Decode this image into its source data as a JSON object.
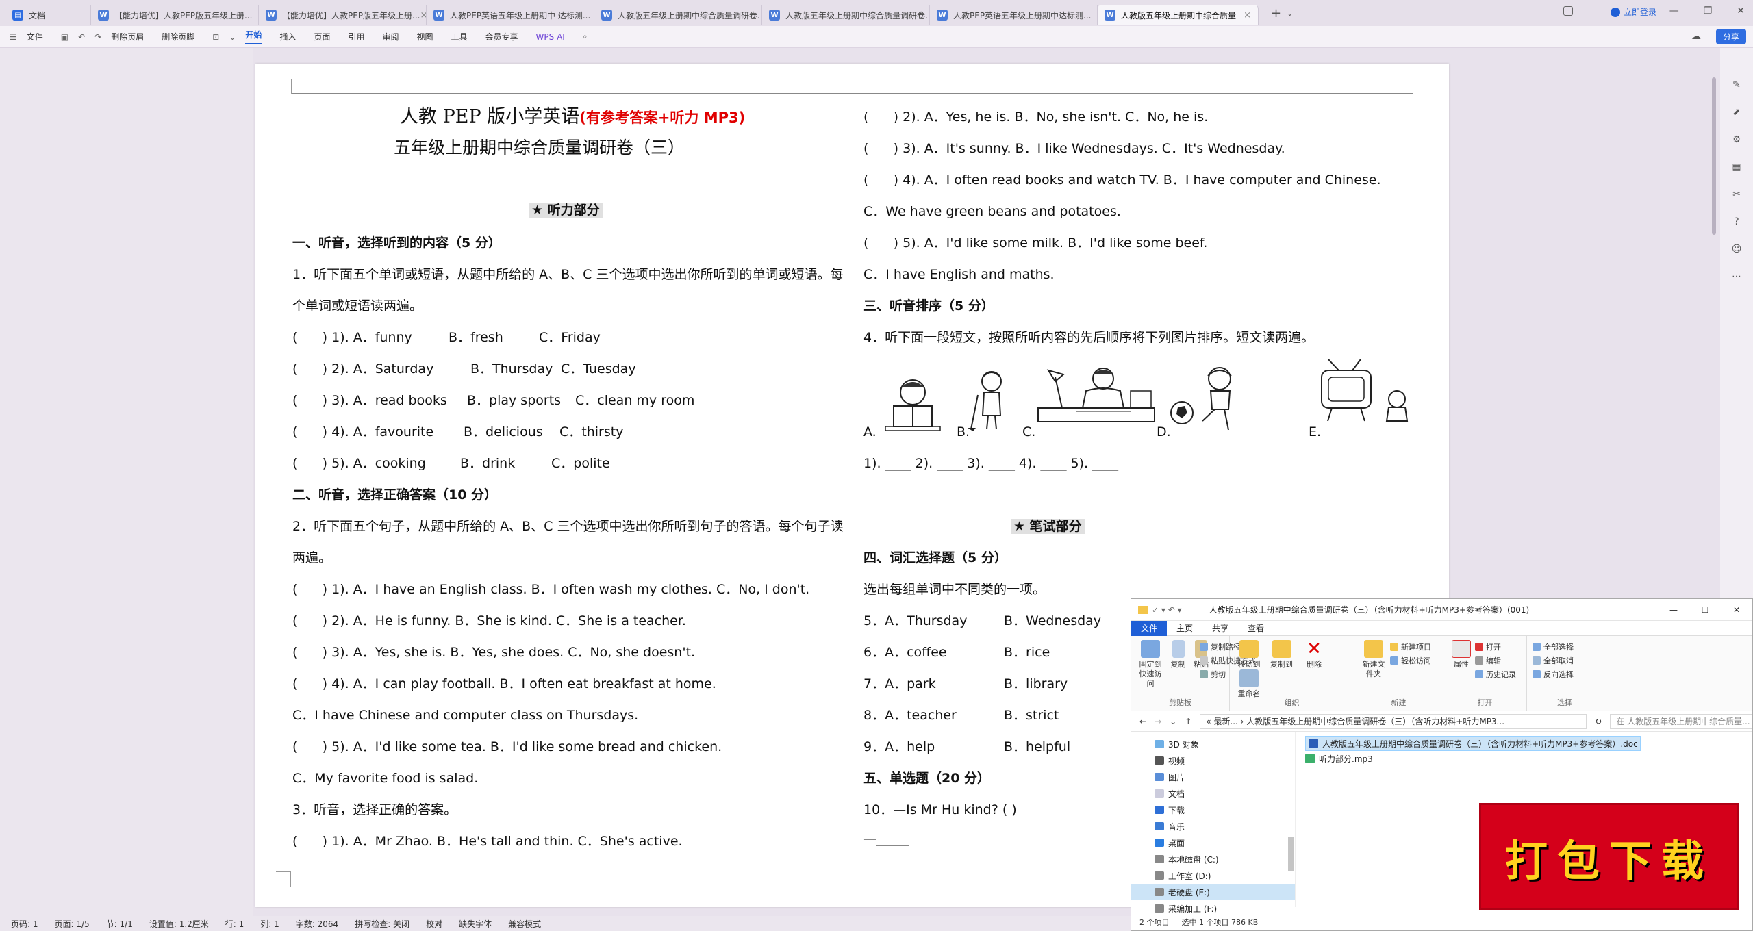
{
  "tabs": [
    {
      "label": "文档",
      "first": true
    },
    {
      "label": "【能力培优】人教PEP版五年级上册..."
    },
    {
      "label": "【能力培优】人教PEP版五年级上册..."
    },
    {
      "label": "人教PEP英语五年级上册期中 达标测..."
    },
    {
      "label": "人教版五年级上册期中综合质量调研卷..."
    },
    {
      "label": "人教版五年级上册期中综合质量调研卷..."
    },
    {
      "label": "人教PEP英语五年级上册期中达标测..."
    },
    {
      "label": "人教版五年级上册期中综合质量"
    }
  ],
  "login": "立即登录",
  "ribbon": {
    "file": "文件",
    "delete_header": "删除页眉",
    "delete_footer": "删除页脚",
    "menus": [
      "开始",
      "插入",
      "页面",
      "引用",
      "审阅",
      "视图",
      "工具",
      "会员专享"
    ],
    "wps_ai": "WPS AI",
    "share": "分享"
  },
  "doc": {
    "title_main": "人教 PEP 版小学英语",
    "title_red": "(有参考答案+听力 MP3)",
    "subtitle": "五年级上册期中综合质量调研卷（三）",
    "listen_section": "★ 听力部分",
    "s1": "一、听音，选择听到的内容（5 分）",
    "s1_desc1": "1．听下面五个单词或短语，从题中所给的 A、B、C 三个选项中选出你所听到的单词或短语。每",
    "s1_desc2": "个单词或短语读两遍。",
    "s1_items": [
      {
        "n": "1).",
        "a": "A．funny",
        "b": "B．fresh",
        "c": "C．Friday"
      },
      {
        "n": "2).",
        "a": "A．Saturday",
        "b": "B．Thursday",
        "c": "C．Tuesday"
      },
      {
        "n": "3).",
        "a": "A．read books",
        "b": "B．play sports",
        "c": "C．clean my room"
      },
      {
        "n": "4).",
        "a": "A．favourite",
        "b": "B．delicious",
        "c": "C．thirsty"
      },
      {
        "n": "5).",
        "a": "A．cooking",
        "b": "B．drink",
        "c": "C．polite"
      }
    ],
    "s2": "二、听音，选择正确答案（10 分）",
    "s2_desc1": "2．听下面五个句子，从题中所给的 A、B、C 三个选项中选出你所听到句子的答语。每个句子读",
    "s2_desc2": "两遍。",
    "s2_items": [
      "1). A．I have an English class.   B．I often wash my clothes.   C．No, I don't.",
      "2). A．He is funny.     B．She is kind.     C．She is a teacher.",
      "3). A．Yes, she is.     B．Yes, she does.    C．No, she doesn't.",
      "4). A．I can play football.   B．I often eat breakfast at home."
    ],
    "s2_i4c": "C．I have Chinese and computer class on Thursdays.",
    "s2_i5": "5). A．I'd like some tea.   B．I'd like some bread and chicken.",
    "s2_i5c": "C．My favorite food is salad.",
    "s3_desc": "3．听音，选择正确的答案。",
    "s3_i1": "1). A．Mr Zhao.              B．He's tall and thin.              C．She's active.",
    "r_items": [
      "2). A．Yes, he is.              B．No, she isn't.               C．No, he is.",
      "3). A．It's sunny.              B．I like Wednesdays.             C．It's Wednesday.",
      "4). A．I often read books and watch TV.     B．I have computer and Chinese."
    ],
    "r_i4c": "C．We have green beans and potatoes.",
    "r_i5": "5). A．I'd like some milk.        B．I'd like some beef.",
    "r_i5c": "C．I have English and maths.",
    "s3": "三、听音排序（5 分）",
    "s3b_desc": "4．听下面一段短文，按照所听内容的先后顺序将下列图片排序。短文读两遍。",
    "pic_labels": [
      "A.",
      "B.",
      "C.",
      "D.",
      "E."
    ],
    "order_line": "1). ____ 2). ____ 3). ____ 4). ____ 5). ____",
    "write_section": "★ 笔试部分",
    "s4": "四、词汇选择题（5 分）",
    "s4_desc": "选出每组单词中不同类的一项。",
    "s4_items": [
      {
        "n": "5．A．Thursday",
        "b": "B．Wednesday"
      },
      {
        "n": "6．A．coffee",
        "b": "B．rice"
      },
      {
        "n": "7．A．park",
        "b": "B．library"
      },
      {
        "n": "8．A．teacher",
        "b": "B．strict"
      },
      {
        "n": "9．A．help",
        "b": "B．helpful"
      }
    ],
    "s5": "五、单选题（20 分）",
    "s5_q": "10．—Is Mr Hu kind? (  )",
    "s5_a": "—_____"
  },
  "explorer": {
    "title": "人教版五年级上册期中综合质量调研卷（三）（含听力材料+听力MP3+参考答案）(001)",
    "tabs": [
      "文件",
      "主页",
      "共享",
      "查看"
    ],
    "groups": {
      "clipboard": {
        "label": "剪贴板",
        "pin": "固定到快速访问",
        "copy": "复制",
        "paste": "粘贴",
        "copy_path": "复制路径",
        "paste_shortcut": "粘贴快捷方式",
        "cut": "剪切"
      },
      "organize": {
        "label": "组织",
        "move": "移动到",
        "copyto": "复制到",
        "delete": "删除",
        "rename": "重命名"
      },
      "new": {
        "label": "新建",
        "folder": "新建文件夹",
        "item": "新建项目",
        "easy": "轻松访问"
      },
      "open": {
        "label": "打开",
        "props": "属性",
        "open": "打开",
        "edit": "编辑",
        "history": "历史记录"
      },
      "select": {
        "label": "选择",
        "all": "全部选择",
        "none": "全部取消",
        "invert": "反向选择"
      }
    },
    "path": "« 最新... › 人教版五年级上册期中综合质量调研卷（三）（含听力材料+听力MP3...",
    "search": "在 人教版五年级上册期中综合质量...",
    "nav": [
      "3D 对象",
      "视频",
      "图片",
      "文档",
      "下载",
      "音乐",
      "桌面",
      "本地磁盘 (C:)",
      "工作室 (D:)",
      "老硬盘 (E:)",
      "采编加工 (F:)"
    ],
    "files": [
      "人教版五年级上册期中综合质量调研卷（三）（含听力材料+听力MP3+参考答案）.doc",
      "听力部分.mp3"
    ],
    "status": [
      "2 个项目",
      "选中 1 个项目  786 KB"
    ]
  },
  "stamp": "打包下载",
  "statusbar": [
    "页码: 1",
    "页面: 1/5",
    "节: 1/1",
    "设置值: 1.2厘米",
    "行: 1",
    "列: 1",
    "字数: 2064",
    "拼写检查: 关闭",
    "校对",
    "缺失字体",
    "兼容模式"
  ]
}
